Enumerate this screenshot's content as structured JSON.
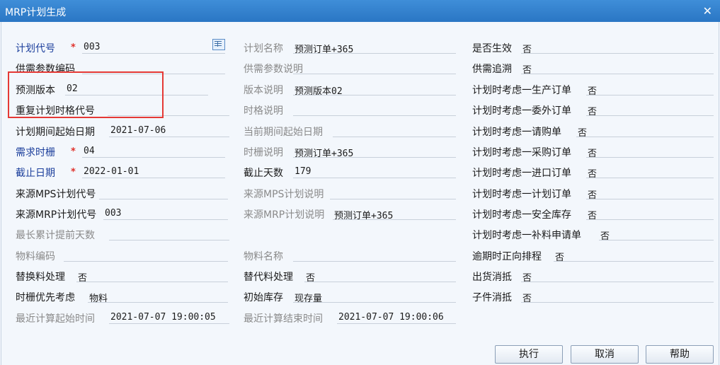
{
  "window": {
    "title": "MRP计划生成"
  },
  "col1": [
    {
      "label": "计划代号",
      "value": "003",
      "required": true,
      "disabled": false
    },
    {
      "label": "供需参数编码",
      "value": "",
      "required": false,
      "disabled": false
    },
    {
      "label": "预测版本",
      "value": "02",
      "required": false,
      "disabled": false
    },
    {
      "label": "重复计划时格代号",
      "value": "",
      "required": false,
      "disabled": false
    },
    {
      "label": "计划期间起始日期",
      "value": "2021-07-06",
      "required": false,
      "disabled": false
    },
    {
      "label": "需求时栅",
      "value": "04",
      "required": true,
      "disabled": false
    },
    {
      "label": "截止日期",
      "value": "2022-01-01",
      "required": true,
      "disabled": false
    },
    {
      "label": "来源MPS计划代号",
      "value": "",
      "required": false,
      "disabled": false
    },
    {
      "label": "来源MRP计划代号",
      "value": "003",
      "required": false,
      "disabled": false
    },
    {
      "label": "最长累计提前天数",
      "value": "",
      "required": false,
      "disabled": true
    },
    {
      "label": "物料编码",
      "value": "",
      "required": false,
      "disabled": true
    },
    {
      "label": "替换料处理",
      "value": "否",
      "required": false,
      "disabled": false
    },
    {
      "label": "时栅优先考虑",
      "value": "物料",
      "required": false,
      "disabled": false
    },
    {
      "label": "最近计算起始时间",
      "value": "2021-07-07 19:00:05",
      "required": false,
      "disabled": true
    }
  ],
  "col2": [
    {
      "label": "计划名称",
      "value": "预测订单+365",
      "disabled": true
    },
    {
      "label": "供需参数说明",
      "value": "",
      "disabled": true
    },
    {
      "label": "版本说明",
      "value": "预测版本02",
      "disabled": true
    },
    {
      "label": "时格说明",
      "value": "",
      "disabled": true
    },
    {
      "label": "当前期间起始日期",
      "value": "",
      "disabled": true
    },
    {
      "label": "时栅说明",
      "value": "预测订单+365",
      "disabled": true
    },
    {
      "label": "截止天数",
      "value": "179",
      "disabled": false
    },
    {
      "label": "来源MPS计划说明",
      "value": "",
      "disabled": true
    },
    {
      "label": "来源MRP计划说明",
      "value": "预测订单+365",
      "disabled": true
    },
    {
      "label": "物料名称",
      "value": "",
      "disabled": true
    },
    {
      "label": "替代料处理",
      "value": "否",
      "disabled": false
    },
    {
      "label": "初始库存",
      "value": "现存量",
      "disabled": false
    },
    {
      "label": "最近计算结束时间",
      "value": "2021-07-07 19:00:06",
      "disabled": true
    }
  ],
  "col3": [
    {
      "label": "是否生效",
      "value": "否"
    },
    {
      "label": "供需追溯",
      "value": "否"
    },
    {
      "label": "计划时考虑一生产订单",
      "value": "否"
    },
    {
      "label": "计划时考虑一委外订单",
      "value": "否"
    },
    {
      "label": "计划时考虑一请购单",
      "value": "否"
    },
    {
      "label": "计划时考虑一采购订单",
      "value": "否"
    },
    {
      "label": "计划时考虑一进口订单",
      "value": "否"
    },
    {
      "label": "计划时考虑一计划订单",
      "value": "否"
    },
    {
      "label": "计划时考虑一安全库存",
      "value": "否"
    },
    {
      "label": "计划时考虑一补料申请单",
      "value": "否"
    },
    {
      "label": "逾期时正向排程",
      "value": "否"
    },
    {
      "label": "出货消抵",
      "value": "否"
    },
    {
      "label": "子件消抵",
      "value": "否"
    }
  ],
  "buttons": {
    "execute": "执行",
    "cancel": "取消",
    "help": "帮助"
  },
  "colors": {
    "title_bar": "#2a76c4",
    "required_label": "#1c3f9c",
    "required_star": "#e0322c",
    "highlight_box": "#e53935"
  }
}
